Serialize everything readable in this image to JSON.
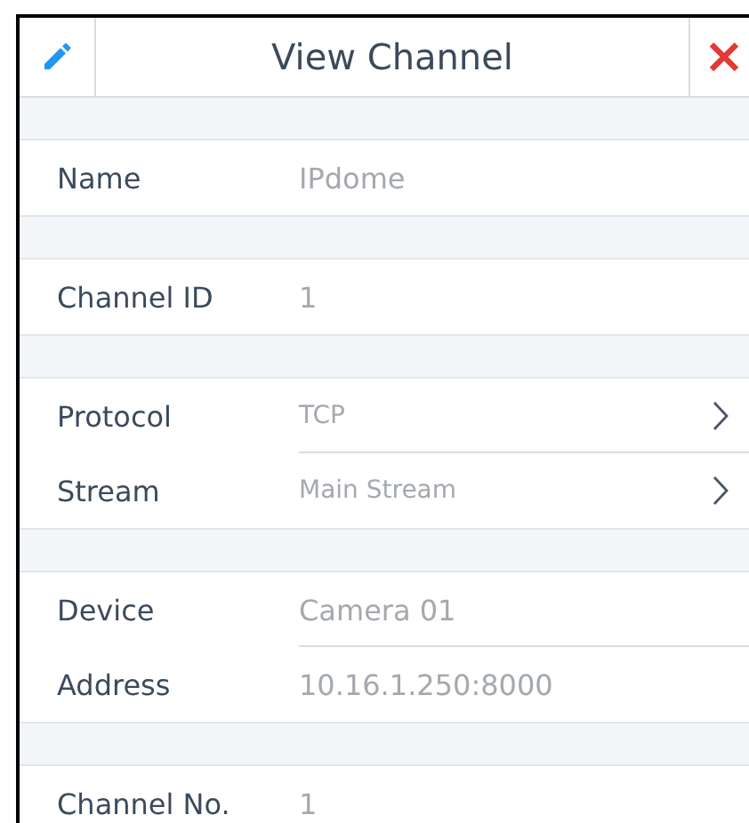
{
  "header": {
    "title": "View Channel"
  },
  "groups": [
    {
      "rows": [
        {
          "kind": "plain",
          "label": "Name",
          "value": "IPdome"
        }
      ]
    },
    {
      "rows": [
        {
          "kind": "plain",
          "label": "Channel ID",
          "value": "1"
        }
      ]
    },
    {
      "rows": [
        {
          "kind": "select",
          "label": "Protocol",
          "value": "TCP"
        },
        {
          "kind": "select",
          "label": "Stream",
          "value": "Main Stream"
        }
      ]
    },
    {
      "rows": [
        {
          "kind": "plain",
          "label": "Device",
          "value": "Camera 01"
        },
        {
          "kind": "plain",
          "label": "Address",
          "value": "10.16.1.250:8000"
        }
      ]
    },
    {
      "rows": [
        {
          "kind": "plain",
          "label": "Channel No.",
          "value": "1"
        }
      ]
    }
  ]
}
